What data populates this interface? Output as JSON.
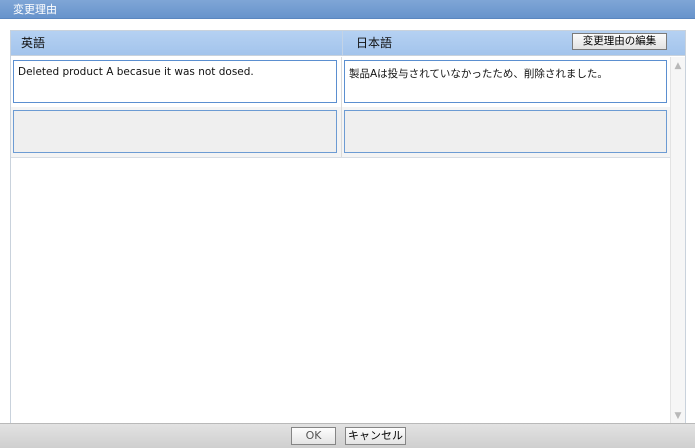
{
  "dialog": {
    "title": "変更理由"
  },
  "grid": {
    "columns": {
      "english": "英語",
      "japanese": "日本語"
    },
    "edit_button_label": "変更理由の編集",
    "rows": [
      {
        "english": "Deleted product A becasue it was not dosed.",
        "japanese": "製品Aは投与されていなかったため、削除されました。"
      },
      {
        "english": "",
        "japanese": ""
      }
    ]
  },
  "scrollbar": {
    "up_glyph": "▲",
    "down_glyph": "▼"
  },
  "footer": {
    "ok_label": "OK",
    "cancel_label": "キャンセル"
  },
  "colors": {
    "titlebar": "#6794cc",
    "header_row": "#a3c4ec",
    "cell_border": "#5b8fd0",
    "footer": "#cfcfcf"
  }
}
